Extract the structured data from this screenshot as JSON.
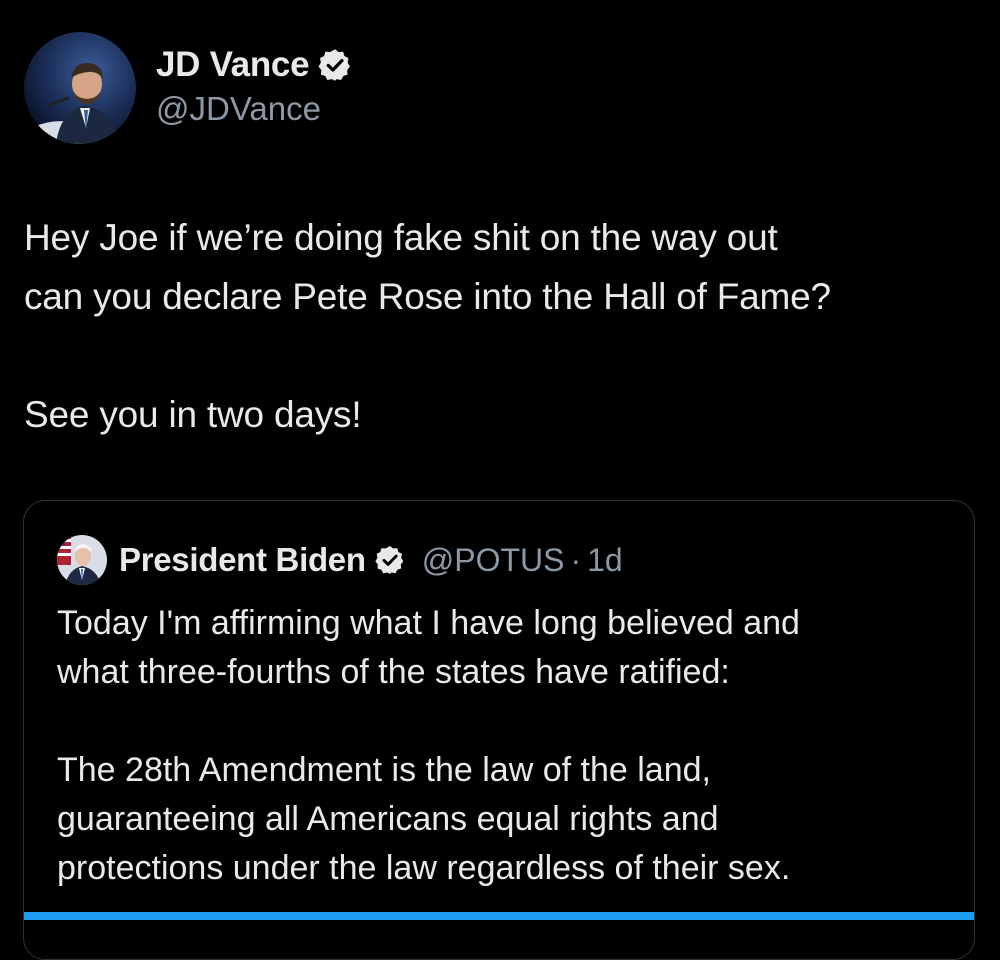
{
  "tweet": {
    "author": {
      "display_name": "JD Vance",
      "handle": "@JDVance",
      "verified_icon": "verified-badge-icon"
    },
    "body": {
      "line_1": "Hey Joe if we’re doing fake shit on the way out",
      "line_2": "can you declare Pete Rose into the Hall of Fame?",
      "line_3": "See you in two days!"
    }
  },
  "quoted_tweet": {
    "author": {
      "display_name": "President Biden",
      "handle": "@POTUS",
      "separator": "·",
      "timestamp": "1d"
    },
    "body": {
      "line_1": "Today I'm affirming what I have long believed and",
      "line_2": "what three-fourths of the states have ratified:",
      "line_3": "The 28th Amendment is the law of the land,",
      "line_4": "guaranteeing all Americans equal rights and",
      "line_5": "protections under the law regardless of their sex."
    }
  },
  "colors": {
    "background": "#000000",
    "text_primary": "#e7e9ea",
    "text_secondary": "#8b98a5",
    "verified_badge": "#1d9bf0",
    "accent": "#1d9bf0",
    "border": "#2f3336"
  }
}
